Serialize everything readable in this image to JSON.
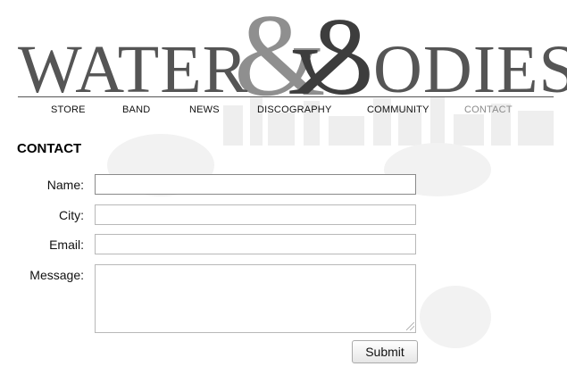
{
  "logo": {
    "left_text": "WATER",
    "ampersand_light": "&",
    "ampersand_dark": "&",
    "right_text": "ODIES",
    "colors": {
      "text": "#555555",
      "amp_light": "#8f8f8f",
      "amp_dark": "#3d3d3d"
    }
  },
  "nav": {
    "items": [
      {
        "label": "STORE"
      },
      {
        "label": "BAND"
      },
      {
        "label": "NEWS"
      },
      {
        "label": "DISCOGRAPHY"
      },
      {
        "label": "COMMUNITY"
      },
      {
        "label": "CONTACT",
        "active": true
      }
    ]
  },
  "page": {
    "title": "CONTACT"
  },
  "form": {
    "name_label": "Name:",
    "name_value": "",
    "city_label": "City:",
    "city_value": "",
    "email_label": "Email:",
    "email_value": "",
    "message_label": "Message:",
    "message_value": "",
    "submit_label": "Submit"
  }
}
